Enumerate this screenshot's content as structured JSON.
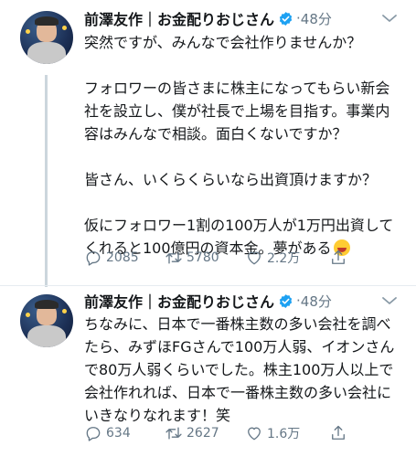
{
  "tweets": [
    {
      "name": "前澤友作｜お金配りおじさん",
      "dot": "·",
      "time": "48分",
      "paragraphs": [
        "突然ですが、みんなで会社作りませんか？",
        "フォロワーの皆さまに株主になってもらい新会社を設立し、僕が社長で上場を目指す。事業内容はみんなで相談。面白くないですか？",
        "皆さん、いくらくらいなら出資頂けますか？",
        "仮にフォロワー1割の100万人が1万円出資してくれると100億円の資本金。夢がある"
      ],
      "reply_count": "2085",
      "retweet_count": "5780",
      "like_count": "2.2万"
    },
    {
      "name": "前澤友作｜お金配りおじさん",
      "dot": "·",
      "time": "48分",
      "paragraphs": [
        "ちなみに、日本で一番株主数の多い会社を調べたら、みずほFGさんで100万人弱、イオンさんで80万人弱くらいでした。株主100万人以上で会社作れれば、日本で一番株主数の多い会社にいきなりなれます！笑"
      ],
      "reply_count": "634",
      "retweet_count": "2627",
      "like_count": "1.6万"
    }
  ],
  "icons": {
    "reply": "reply-icon",
    "retweet": "retweet-icon",
    "like": "heart-icon",
    "share": "share-icon",
    "verified": "verified-badge-icon",
    "caret": "chevron-down-icon",
    "emoji": "grinning-squinting-face-emoji"
  },
  "colors": {
    "text": "#14171a",
    "secondary": "#657786",
    "verified": "#1da1f2",
    "thread_line": "#ccd6dd"
  }
}
